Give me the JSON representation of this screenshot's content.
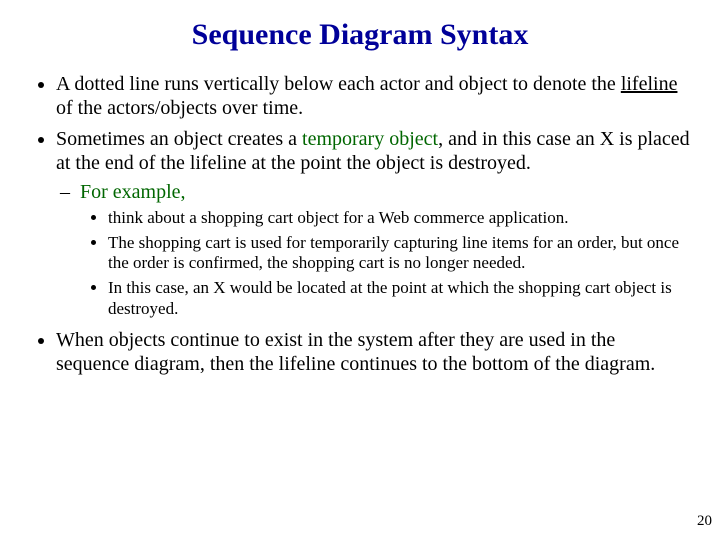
{
  "title": "Sequence Diagram Syntax",
  "bullets": {
    "b1_pre": "A dotted line runs vertically below each actor and object to denote the ",
    "b1_u": "lifeline",
    "b1_post": " of the actors/objects over time.",
    "b2_pre": "Sometimes an object creates a ",
    "b2_g": "temporary object",
    "b2_post": ", and in this case an X is placed at the end of the lifeline at the point the object is destroyed.",
    "b2_sub": "For example,",
    "b2_s1": "think about a shopping cart object for a Web commerce application.",
    "b2_s2": "The shopping cart is used for temporarily capturing line items for an order, but once the order is confirmed, the shopping cart is no longer needed.",
    "b2_s3": "In this case, an X would be located at the point at which the shopping cart object is destroyed.",
    "b3": "When objects continue to exist in the system after they are used in the sequence diagram, then the lifeline continues to the bottom of the diagram."
  },
  "page_number": "20"
}
